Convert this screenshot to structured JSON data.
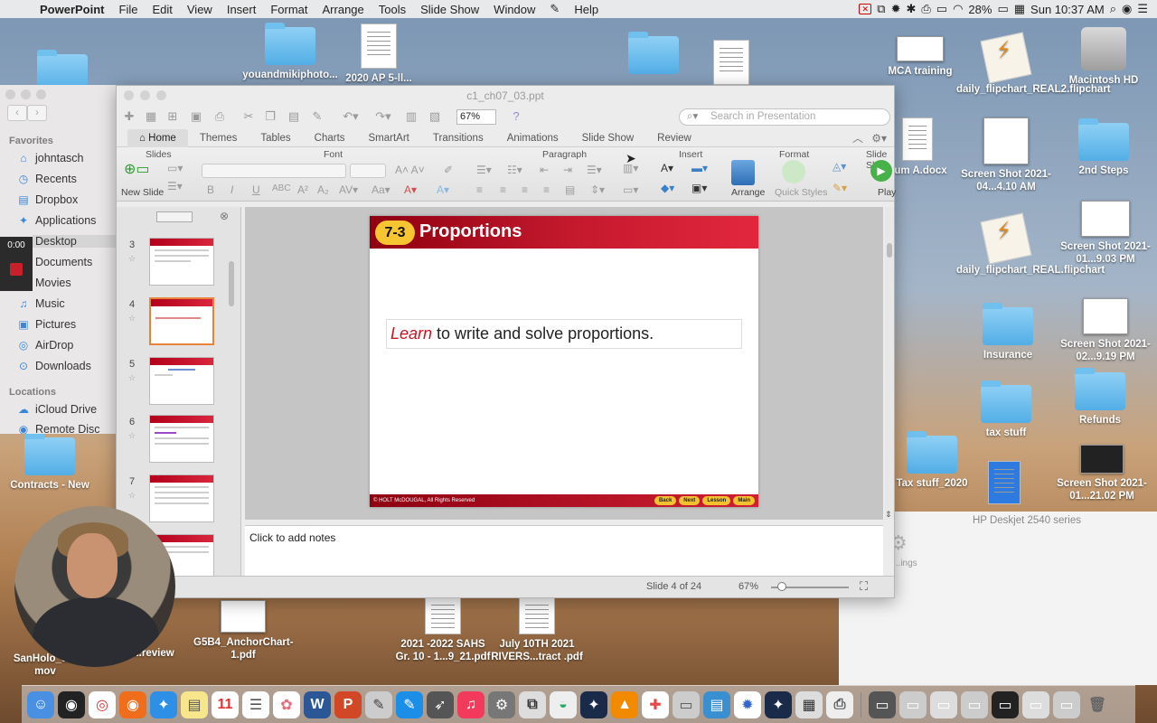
{
  "menubar": {
    "app_name": "PowerPoint",
    "items": [
      "File",
      "Edit",
      "View",
      "Insert",
      "Format",
      "Arrange",
      "Tools",
      "Slide Show",
      "Window",
      "Help"
    ],
    "battery": "28%",
    "clock": "Sun 10:37 AM"
  },
  "desktop": {
    "icons": [
      {
        "label": "MCA training"
      },
      {
        "label": "daily_flipchart_REAL2.flipchart"
      },
      {
        "label": "Macintosh HD"
      },
      {
        "label": "Screen Shot 2021-04...4.10 AM"
      },
      {
        "label": "2nd Steps"
      },
      {
        "label": "dum A.docx"
      },
      {
        "label": "daily_flipchart_REAL.flipchart"
      },
      {
        "label": "Screen Shot 2021-01...9.03 PM"
      },
      {
        "label": "Insurance"
      },
      {
        "label": "Screen Shot 2021-02...9.19 PM"
      },
      {
        "label": "tax stuff"
      },
      {
        "label": "Refunds"
      },
      {
        "label": "Tax stuff_2020"
      },
      {
        "label": "Screen Shot 2021-01...21.02 PM"
      },
      {
        "label": "Contracts - New"
      },
      {
        "label": "SanHolo_S..."
      },
      {
        "label": "mov"
      },
      {
        "label": "...review"
      },
      {
        "label": "G5B4_AnchorChart-1.pdf"
      },
      {
        "label": "2021 -2022 SAHS Gr. 10 - 1...9_21.pdf"
      },
      {
        "label": "July 10TH 2021 RIVERS...tract .pdf"
      },
      {
        "label": "youandmikiphoto..."
      },
      {
        "label": "2020 AP 5-ll..."
      }
    ]
  },
  "finder": {
    "favorites_label": "Favorites",
    "favorites": [
      "johntasch",
      "Recents",
      "Dropbox",
      "Applications",
      "Desktop",
      "Documents",
      "Movies",
      "Music",
      "Pictures",
      "AirDrop",
      "Downloads"
    ],
    "locations_label": "Locations",
    "locations": [
      "iCloud Drive",
      "Remote Disc"
    ]
  },
  "recorder": {
    "time": "0:00"
  },
  "ppt": {
    "filename": "c1_ch07_03.ppt",
    "zoom": "67%",
    "search_placeholder": "Search in Presentation",
    "tabs": [
      "Home",
      "Themes",
      "Tables",
      "Charts",
      "SmartArt",
      "Transitions",
      "Animations",
      "Slide Show",
      "Review"
    ],
    "ribbon_groups": [
      "Slides",
      "Font",
      "Paragraph",
      "Insert",
      "Format",
      "Slide Sh"
    ],
    "new_slide": "New Slide",
    "arrange": "Arrange",
    "quick_styles": "Quick Styles",
    "play": "Play",
    "thumbnails": [
      {
        "num": "3"
      },
      {
        "num": "4"
      },
      {
        "num": "5"
      },
      {
        "num": "6"
      },
      {
        "num": "7"
      },
      {
        "num": "8"
      }
    ],
    "slide": {
      "badge": "7-3",
      "title": "Proportions",
      "learn_word": "Learn",
      "learn_rest": " to write and solve proportions.",
      "footer": "© HOLT McDOUGAL, All Rights Reserved",
      "buttons": [
        "Back",
        "Next",
        "Lesson",
        "Main"
      ]
    },
    "notes_placeholder": "Click to add notes",
    "status": {
      "slide_info": "Slide 4 of 24",
      "zoom": "67%"
    }
  },
  "printer": {
    "label": "HP Deskjet 2540 series",
    "settings": "...ings"
  }
}
